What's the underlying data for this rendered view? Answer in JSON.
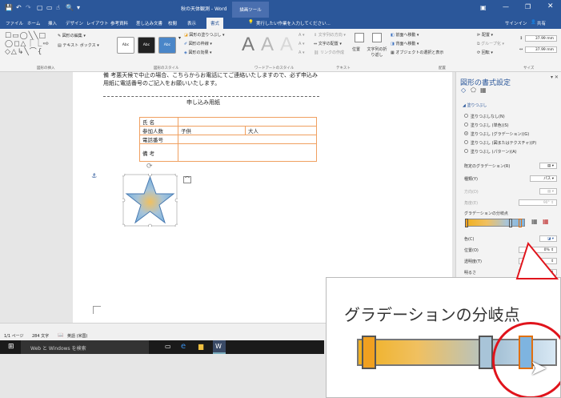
{
  "window": {
    "title": "秋の天体観測 - Word",
    "context_tab": "描画ツール",
    "signin": "サインイン",
    "share": "共有"
  },
  "tabs": [
    "ファイル",
    "ホーム",
    "挿入",
    "デザイン",
    "レイアウト",
    "参考資料",
    "差し込み文書",
    "校閲",
    "表示",
    "書式"
  ],
  "tell_me": "実行したい作業を入力してください...",
  "ribbon": {
    "edit_shape": "図形の編集",
    "text_box": "テキスト ボックス",
    "group_insert": "図形の挿入",
    "style_abc": "Abc",
    "fill": "図形の塗りつぶし",
    "outline": "図形の枠線",
    "effects": "図形の効果",
    "group_styles": "図形のスタイル",
    "group_wordart": "ワードアートのスタイル",
    "text_direction": "文字列の方向",
    "text_align": "文字の配置",
    "create_link": "リンクの作成",
    "group_text": "テキスト",
    "position": "位置",
    "wrap": "文字列の折り返し",
    "bring_forward": "前面へ移動",
    "send_backward": "背面へ移動",
    "selection_pane": "オブジェクトの選択と表示",
    "align": "配置",
    "group_btn": "グループ化",
    "rotate": "回転",
    "group_arrange": "配置",
    "height": "37.99 mm",
    "width": "37.99 mm",
    "group_size": "サイズ"
  },
  "document": {
    "line1": "備 考悪天候で中止の場合、こちらからお電話にてご連絡いたしますので、必ず申込み",
    "line2": "用紙に電話番号のご記入をお願いいたします。",
    "form_title": "申し込み用紙",
    "rows": [
      {
        "label": "氏 名",
        "value": "",
        "extra": ""
      },
      {
        "label": "参加人数",
        "value": "子供",
        "extra": "大人"
      },
      {
        "label": "電話番号",
        "value": "",
        "extra": ""
      },
      {
        "label": "備 考",
        "value": "",
        "extra": ""
      }
    ],
    "para_mark": "↵"
  },
  "pane": {
    "title": "図形の書式設定",
    "section": "塗りつぶし",
    "options": [
      {
        "label": "塗りつぶしなし(N)",
        "selected": false
      },
      {
        "label": "塗りつぶし (単色)(S)",
        "selected": false
      },
      {
        "label": "塗りつぶし (グラデーション)(G)",
        "selected": true
      },
      {
        "label": "塗りつぶし (図またはテクスチャ)(P)",
        "selected": false
      },
      {
        "label": "塗りつぶし (パターン)(A)",
        "selected": false
      }
    ],
    "preset_label": "既定のグラデーション(R)",
    "type_label": "種類(Y)",
    "type_value": "パス",
    "direction_label": "方向(D)",
    "angle_label": "角度(E)",
    "angle_value": "90°",
    "stops_label": "グラデーションの分岐点",
    "color_label": "色(C)",
    "position_label": "位置(O)",
    "position_value": "0%",
    "transparency_label": "透明度(T)",
    "brightness_label": "明るさ"
  },
  "status": {
    "page": "1/1 ページ",
    "words": "284 文字",
    "lang": "英語 (米国)"
  },
  "taskbar": {
    "search": "Web と Windows を検索"
  },
  "zoom": {
    "label": "グラデーションの分岐点"
  },
  "colors": {
    "word_blue": "#2b579a",
    "accent_red": "#e0141c",
    "star_fill": "#7eb4e0",
    "star_center": "#f0c060"
  }
}
